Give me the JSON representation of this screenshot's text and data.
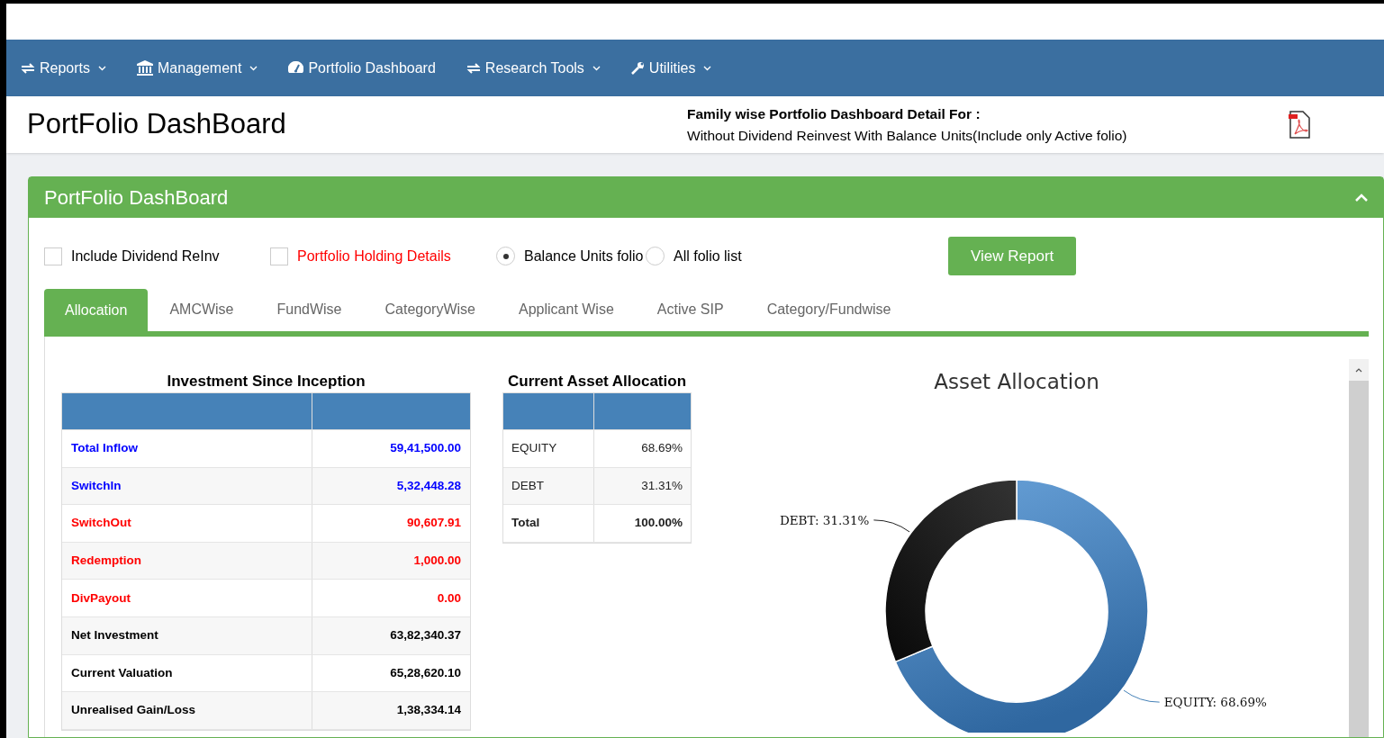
{
  "nav": [
    {
      "label": "Reports",
      "kind": "arrows",
      "dropdown": true
    },
    {
      "label": "Management",
      "kind": "bank",
      "dropdown": true
    },
    {
      "label": "Portfolio Dashboard",
      "kind": "gauge",
      "dropdown": false
    },
    {
      "label": "Research Tools",
      "kind": "arrows",
      "dropdown": true
    },
    {
      "label": "Utilities",
      "kind": "wrench",
      "dropdown": true
    }
  ],
  "header": {
    "title": "PortFolio DashBoard",
    "detail_heading": "Family wise Portfolio Dashboard Detail For :",
    "detail_text": "Without Dividend Reinvest With Balance Units(Include only Active folio)"
  },
  "panel": {
    "title": "PortFolio DashBoard",
    "options": [
      {
        "kind": "checkbox",
        "label": "Include Dividend ReInv",
        "checked": false,
        "color": "#000000"
      },
      {
        "kind": "checkbox",
        "label": "Portfolio Holding Details",
        "checked": false,
        "color": "#ff0000"
      },
      {
        "kind": "radio",
        "label": "Balance Units folio",
        "selected": true,
        "color": "#000000"
      },
      {
        "kind": "radio",
        "label": "All folio list",
        "selected": false,
        "color": "#000000"
      }
    ],
    "view_button": "View Report",
    "tabs": [
      {
        "label": "Allocation",
        "selected": true
      },
      {
        "label": "AMCWise",
        "selected": false
      },
      {
        "label": "FundWise",
        "selected": false
      },
      {
        "label": "CategoryWise",
        "selected": false
      },
      {
        "label": "Applicant Wise",
        "selected": false
      },
      {
        "label": "Active SIP",
        "selected": false
      },
      {
        "label": "Category/Fundwise",
        "selected": false
      }
    ],
    "investment": {
      "title": "Investment Since Inception",
      "rows": [
        {
          "label": "Total Inflow",
          "value": "59,41,500.00",
          "color": "#0000ff"
        },
        {
          "label": "SwitchIn",
          "value": "5,32,448.28",
          "color": "#0000ff"
        },
        {
          "label": "SwitchOut",
          "value": "90,607.91",
          "color": "#ff0000"
        },
        {
          "label": "Redemption",
          "value": "1,000.00",
          "color": "#ff0000"
        },
        {
          "label": "DivPayout",
          "value": "0.00",
          "color": "#ff0000"
        },
        {
          "label": "Net Investment",
          "value": "63,82,340.37",
          "color": "#000000"
        },
        {
          "label": "Current Valuation",
          "value": "65,28,620.10",
          "color": "#000000"
        },
        {
          "label": "Unrealised Gain/Loss",
          "value": "1,38,334.14",
          "color": "#000000"
        }
      ]
    },
    "allocation": {
      "title": "Current Asset Allocation",
      "rows": [
        {
          "kind": "item",
          "label": "EQUITY",
          "value": "68.69%"
        },
        {
          "kind": "item",
          "label": "DEBT",
          "value": "31.31%"
        },
        {
          "kind": "total",
          "label": "Total",
          "value": "100.00%"
        }
      ]
    },
    "chart_data": {
      "type": "donut",
      "title": "Asset Allocation",
      "values": [
        68.69,
        31.31
      ],
      "value_labels": [
        "EQUITY: 68.69%",
        "DEBT: 31.31%"
      ]
    }
  }
}
